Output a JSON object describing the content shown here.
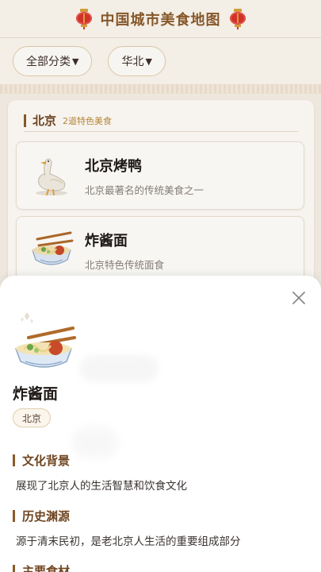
{
  "header": {
    "title": "中国城市美食地图",
    "left_icon": "lantern-icon",
    "right_icon": "lantern-icon"
  },
  "filters": {
    "category": "全部分类",
    "region": "华北",
    "arrow": "▼"
  },
  "region_group": {
    "name": "北京",
    "count_label": "2道特色美食"
  },
  "foods": [
    {
      "name": "北京烤鸭",
      "desc": "北京最著名的传统美食之一",
      "icon": "roast-duck-icon"
    },
    {
      "name": "炸酱面",
      "desc": "北京特色传统面食",
      "icon": "noodle-bowl-icon"
    }
  ],
  "detail": {
    "title": "炸酱面",
    "tag": "北京",
    "icon": "noodle-bowl-icon",
    "close_icon": "close-icon",
    "sections": [
      {
        "heading": "文化背景",
        "body": "展现了北京人的生活智慧和饮食文化"
      },
      {
        "heading": "历史渊源",
        "body": "源于清末民初，是老北京人生活的重要组成部分"
      },
      {
        "heading": "主要食材",
        "body": ""
      }
    ]
  },
  "colors": {
    "accent": "#8b5a2b",
    "background": "#f6efe6",
    "lantern": "#d6342a"
  }
}
